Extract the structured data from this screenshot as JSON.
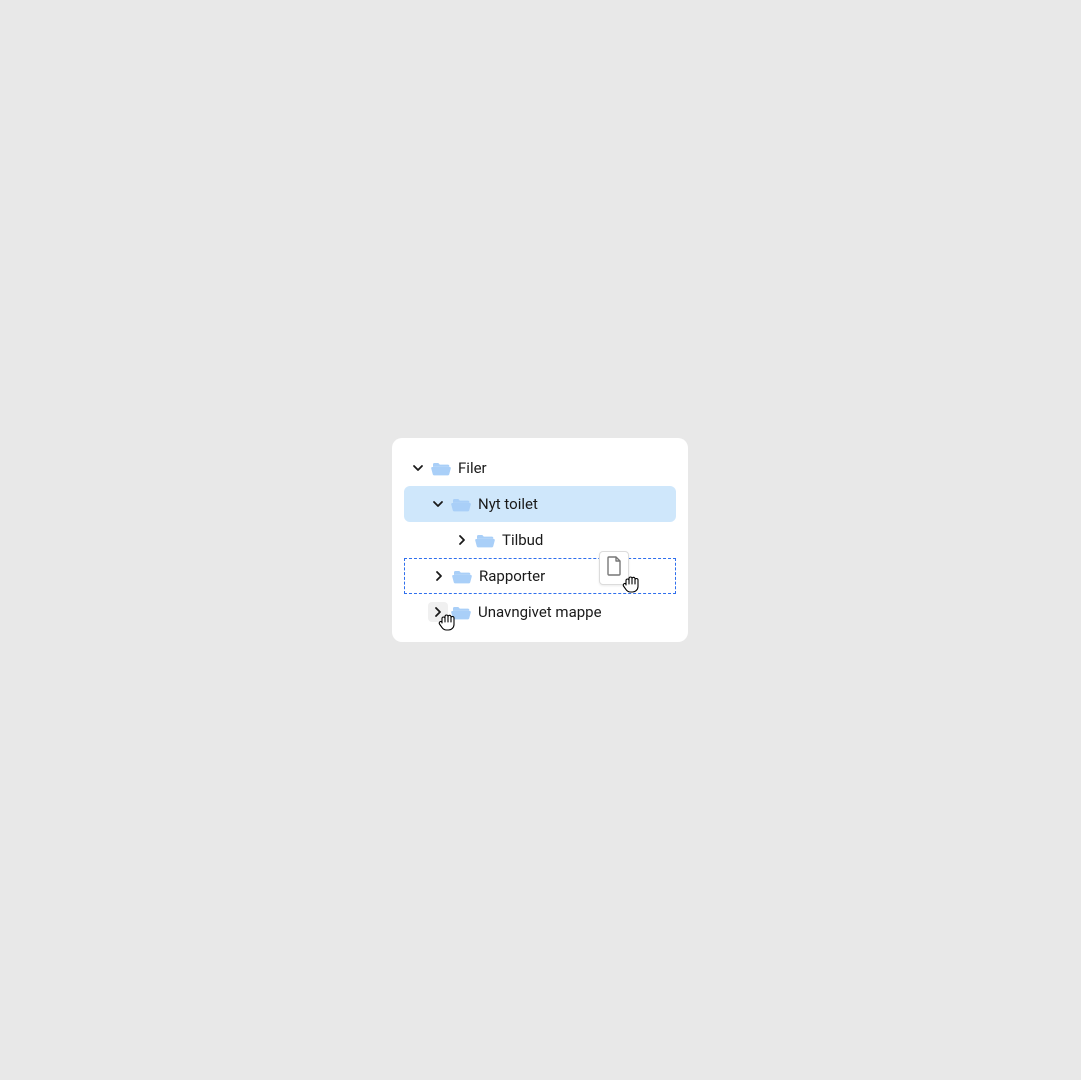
{
  "tree": {
    "root": {
      "label": "Filer"
    },
    "item1": {
      "label": "Nyt toilet"
    },
    "item2": {
      "label": "Tilbud"
    },
    "item3": {
      "label": "Rapporter"
    },
    "item4": {
      "label": "Unavngivet mappe"
    }
  },
  "colors": {
    "folder_fill": "#A9CFF8",
    "folder_stroke_area": "#A9CFF8",
    "selection_bg": "#CFE7FB",
    "drop_border": "#2F6FED"
  }
}
